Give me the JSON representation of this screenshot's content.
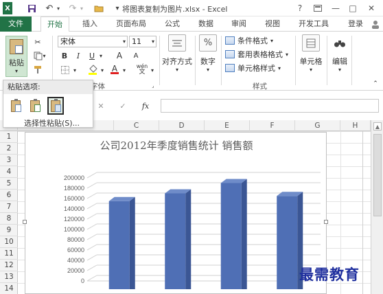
{
  "titlebar": {
    "app_badge": "X",
    "title": "将图表复制为图片.xlsx - Excel",
    "help": "?",
    "controls": [
      "restore",
      "minimize",
      "maximize",
      "close"
    ]
  },
  "tabs": [
    {
      "label": "文件"
    },
    {
      "label": "开始"
    },
    {
      "label": "插入"
    },
    {
      "label": "页面布局"
    },
    {
      "label": "公式"
    },
    {
      "label": "数据"
    },
    {
      "label": "审阅"
    },
    {
      "label": "视图"
    },
    {
      "label": "开发工具"
    },
    {
      "label": "登录"
    }
  ],
  "ribbon": {
    "clipboard": {
      "paste_label": "粘贴"
    },
    "font": {
      "name": "宋体",
      "size": "11",
      "group_label": "字体",
      "bold": "B",
      "italic": "I",
      "underline": "U",
      "grow": "A",
      "shrink": "A",
      "color": "A",
      "wen": "wén"
    },
    "alignment": {
      "label": "对齐方式"
    },
    "number": {
      "label": "数字",
      "icon_text": "%"
    },
    "styles": {
      "items": [
        "条件格式",
        "套用表格格式",
        "单元格样式"
      ],
      "group_label": "样式"
    },
    "cells": {
      "label": "单元格"
    },
    "editing": {
      "label": "编辑"
    }
  },
  "paste_menu": {
    "header": "粘贴选项:",
    "special": "选择性粘贴(S)..."
  },
  "formula_bar": {
    "fx": "fx",
    "cancel": "✕",
    "enter": "✓",
    "value": ""
  },
  "columns": [
    "C",
    "D",
    "E",
    "F",
    "G",
    "H"
  ],
  "rows": [
    "1",
    "2",
    "3",
    "4",
    "5",
    "6",
    "7",
    "8",
    "9",
    "10",
    "11",
    "12",
    "13",
    "14"
  ],
  "chart_data": {
    "type": "bar",
    "title": "公司2012年季度销售统计 销售额",
    "categories": [
      "",
      "",
      "",
      ""
    ],
    "values": [
      155000,
      170000,
      190000,
      165000
    ],
    "ylim": [
      0,
      200000
    ],
    "yticks": [
      "200000",
      "180000",
      "160000",
      "140000",
      "120000",
      "100000",
      "80000",
      "60000",
      "40000",
      "20000",
      "0"
    ],
    "bar_color": "#4f6fb5",
    "grid": true
  },
  "watermark": "最需教育"
}
